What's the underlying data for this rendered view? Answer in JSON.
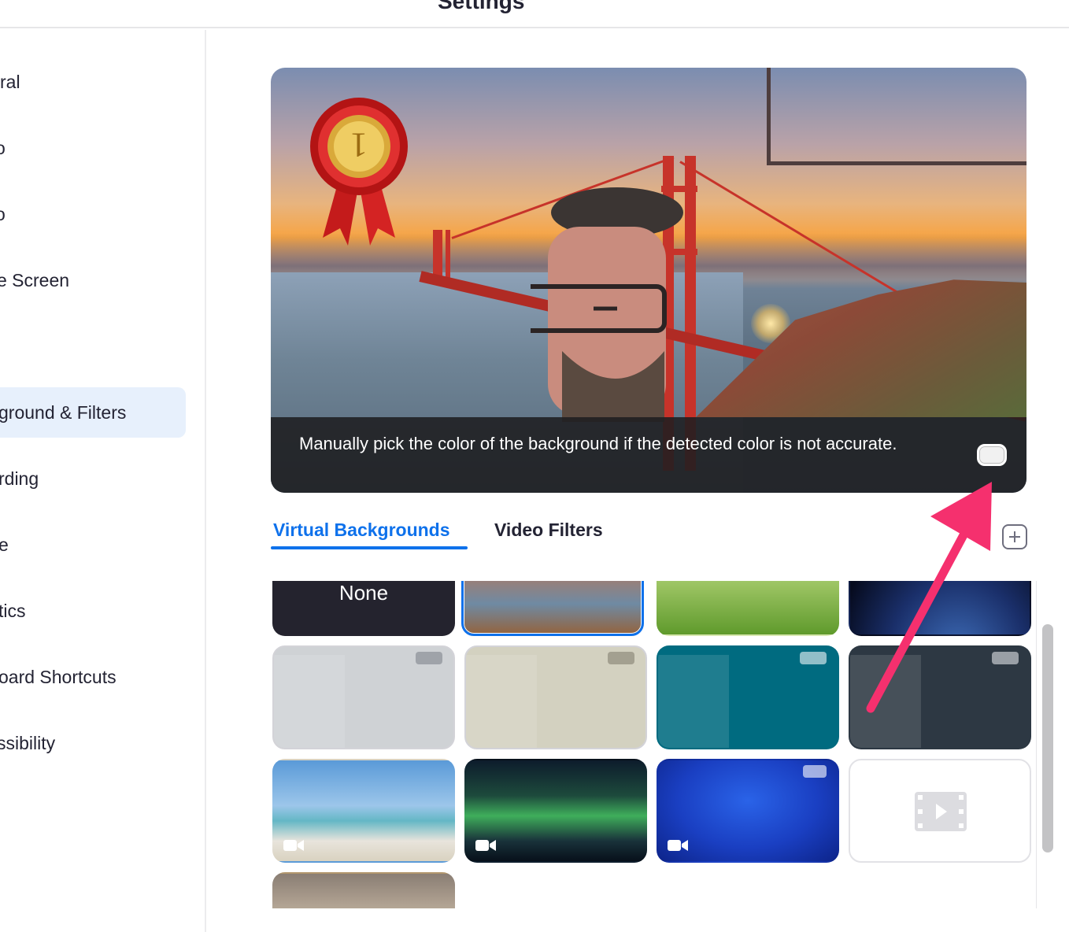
{
  "window": {
    "title": "Settings"
  },
  "sidebar": {
    "items": [
      {
        "label": "ral",
        "active": false
      },
      {
        "label": "o",
        "active": false
      },
      {
        "label": "o",
        "active": false
      },
      {
        "label": "e Screen",
        "active": false
      },
      {
        "label": "",
        "active": false
      },
      {
        "label": "ground & Filters",
        "active": true
      },
      {
        "label": "rding",
        "active": false
      },
      {
        "label": "e",
        "active": false
      },
      {
        "label": "tics",
        "active": false
      },
      {
        "label": "oard Shortcuts",
        "active": false
      },
      {
        "label": "ssibility",
        "active": false
      }
    ]
  },
  "preview": {
    "overlay_text": "Manually pick the color of the background if the detected color is not accurate."
  },
  "tabs": {
    "virtual_backgrounds": "Virtual Backgrounds",
    "video_filters": "Video Filters"
  },
  "backgrounds": {
    "none_label": "None"
  },
  "colors": {
    "accent": "#0e71eb",
    "active_nav_bg": "#e7f0fc",
    "annotation_arrow": "#f5306e"
  }
}
